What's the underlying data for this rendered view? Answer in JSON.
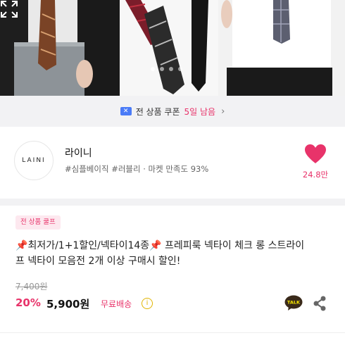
{
  "hero": {
    "image": "product-photo-neckties",
    "slide_count": 4,
    "active_slide": 1
  },
  "coupon": {
    "icon": "coupon-icon",
    "label": "전 상품 쿠폰",
    "highlight": "5일 남음",
    "chevron": "›"
  },
  "shop": {
    "logo_text": "LAINI",
    "name": "라이니",
    "tags": "#심플베이직 #러블리 · 마켓 만족도 93%",
    "likes": "24.8만",
    "heart_color": "#e8336a"
  },
  "product": {
    "badge": "전 상품 쿨프",
    "title_pin1": "📌",
    "title_part1": "최저가/1+1할인/넥타이14종",
    "title_pin2": "📌",
    "title_part2": " 프레피룩 넥타이 체크 롱 스트라이프 넥타이 모음전 2개 이상 구매시 할인!",
    "original_price": "7,400원",
    "discount": "20%",
    "price": "5,900원",
    "shipping": "무료배송",
    "info_symbol": "i",
    "talk_label": "TALK",
    "accent_color": "#e8336a"
  }
}
